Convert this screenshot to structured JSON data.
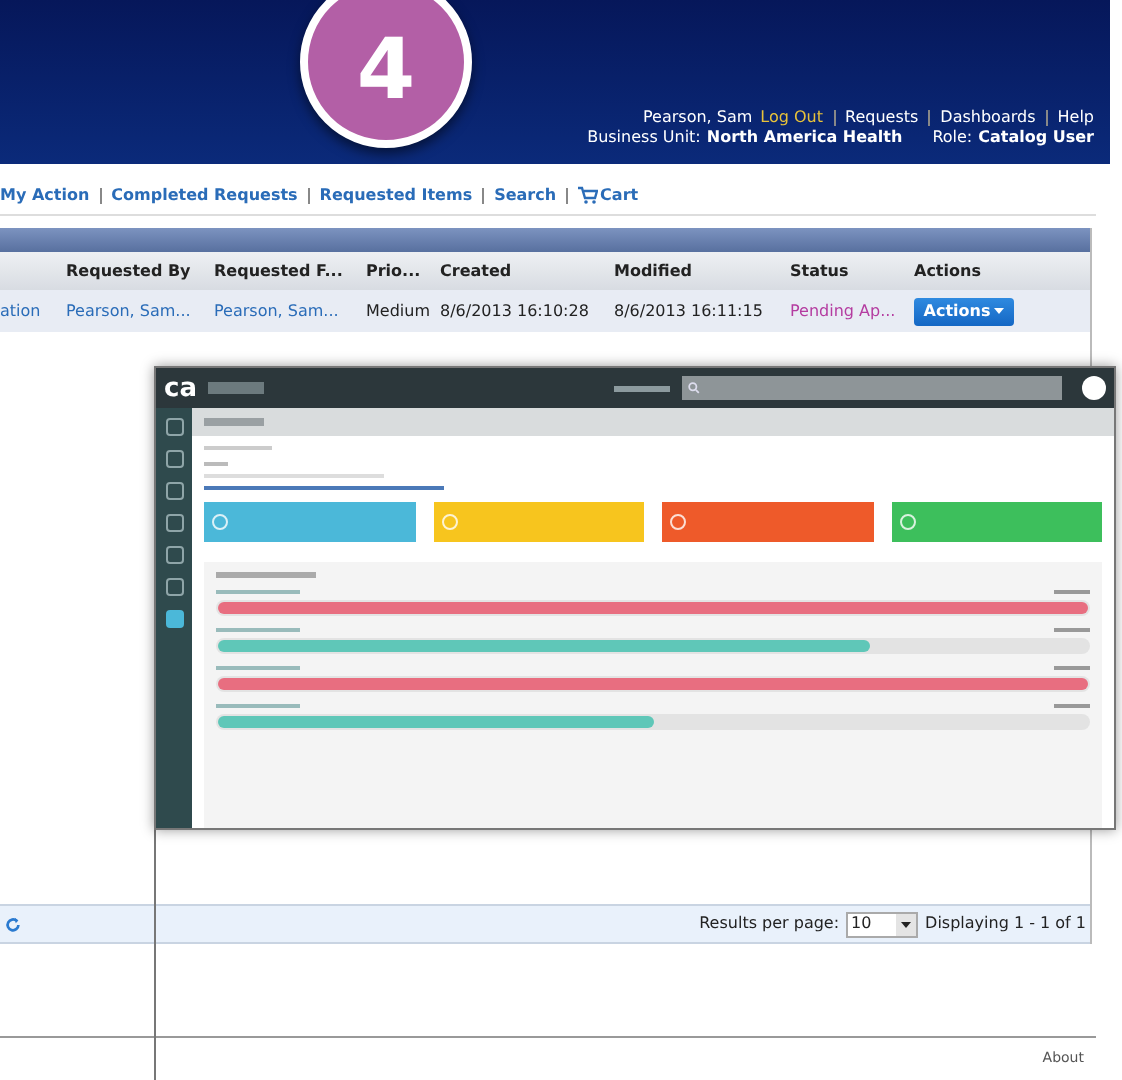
{
  "step_badge": "4",
  "header": {
    "user": "Pearson, Sam",
    "logout": "Log Out",
    "links": [
      "Requests",
      "Dashboards",
      "Help"
    ],
    "business_unit_label": "Business Unit:",
    "business_unit": "North America Health",
    "role_label": "Role:",
    "role": "Catalog User"
  },
  "nav": [
    {
      "label": "My Action"
    },
    {
      "label": "Completed Requests"
    },
    {
      "label": "Requested Items"
    },
    {
      "label": "Search"
    },
    {
      "label": "Cart",
      "kind": "cart"
    }
  ],
  "table": {
    "columns": [
      "",
      "Requested By",
      "Requested F...",
      "Prio...",
      "Created",
      "Modified",
      "Status",
      "Actions"
    ],
    "rows": [
      {
        "cells": [
          "ation",
          "Pearson, Sam...",
          "Pearson, Sam...",
          "Medium",
          "8/6/2013 16:10:28",
          "8/6/2013 16:11:15",
          "Pending Ap..."
        ],
        "action": "Actions"
      }
    ]
  },
  "inset": {
    "logo": "ca",
    "tiles": [
      {
        "color": "#4bb8d9"
      },
      {
        "color": "#f7c51e"
      },
      {
        "color": "#ee5a2a"
      },
      {
        "color": "#3dbf5c"
      }
    ],
    "requests": [
      {
        "kind": "failed",
        "level": 1
      },
      {
        "kind": "progress",
        "level": 0.75
      },
      {
        "kind": "failed",
        "level": 1
      },
      {
        "kind": "progress",
        "level": 0.5
      }
    ]
  },
  "pager": {
    "label": "Results per page:",
    "value": "10",
    "display": "Displaying 1 - 1 of 1"
  },
  "footer": {
    "link": "About"
  }
}
